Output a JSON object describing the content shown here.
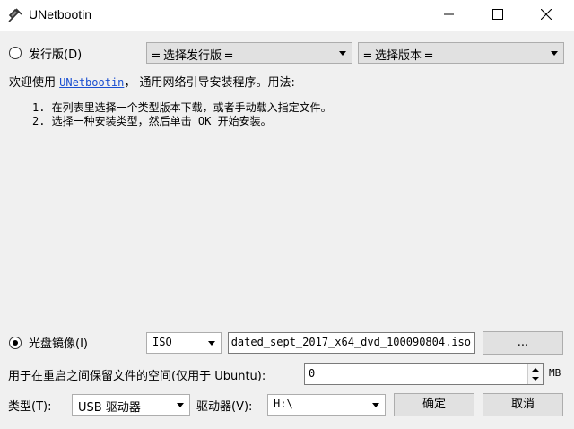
{
  "window": {
    "title": "UNetbootin",
    "icon": "unetbootin-icon"
  },
  "distro": {
    "radio_label": "发行版(D)",
    "selected": false,
    "distro_select": "═ 选择发行版 ═",
    "version_select": "═ 选择版本 ═"
  },
  "intro": {
    "prefix": "欢迎使用",
    "link": "UNetbootin",
    "suffix": "， 通用网络引导安装程序。用法:",
    "steps": [
      "1. 在列表里选择一个类型版本下载，或者手动载入指定文件。",
      "2. 选择一种安装类型，然后单击 OK 开始安装。"
    ]
  },
  "diskimage": {
    "radio_label": "光盘镜像(I)",
    "selected": true,
    "type_select": "ISO",
    "path_value": "dated_sept_2017_x64_dvd_100090804.iso",
    "browse_label": "..."
  },
  "persistence": {
    "label": "用于在重启之间保留文件的空间(仅用于 Ubuntu):",
    "value": "0",
    "unit": "MB"
  },
  "bottom": {
    "type_label": "类型(T):",
    "type_value": "USB 驱动器",
    "drive_label": "驱动器(V):",
    "drive_value": "H:\\",
    "ok_label": "确定",
    "cancel_label": "取消"
  }
}
